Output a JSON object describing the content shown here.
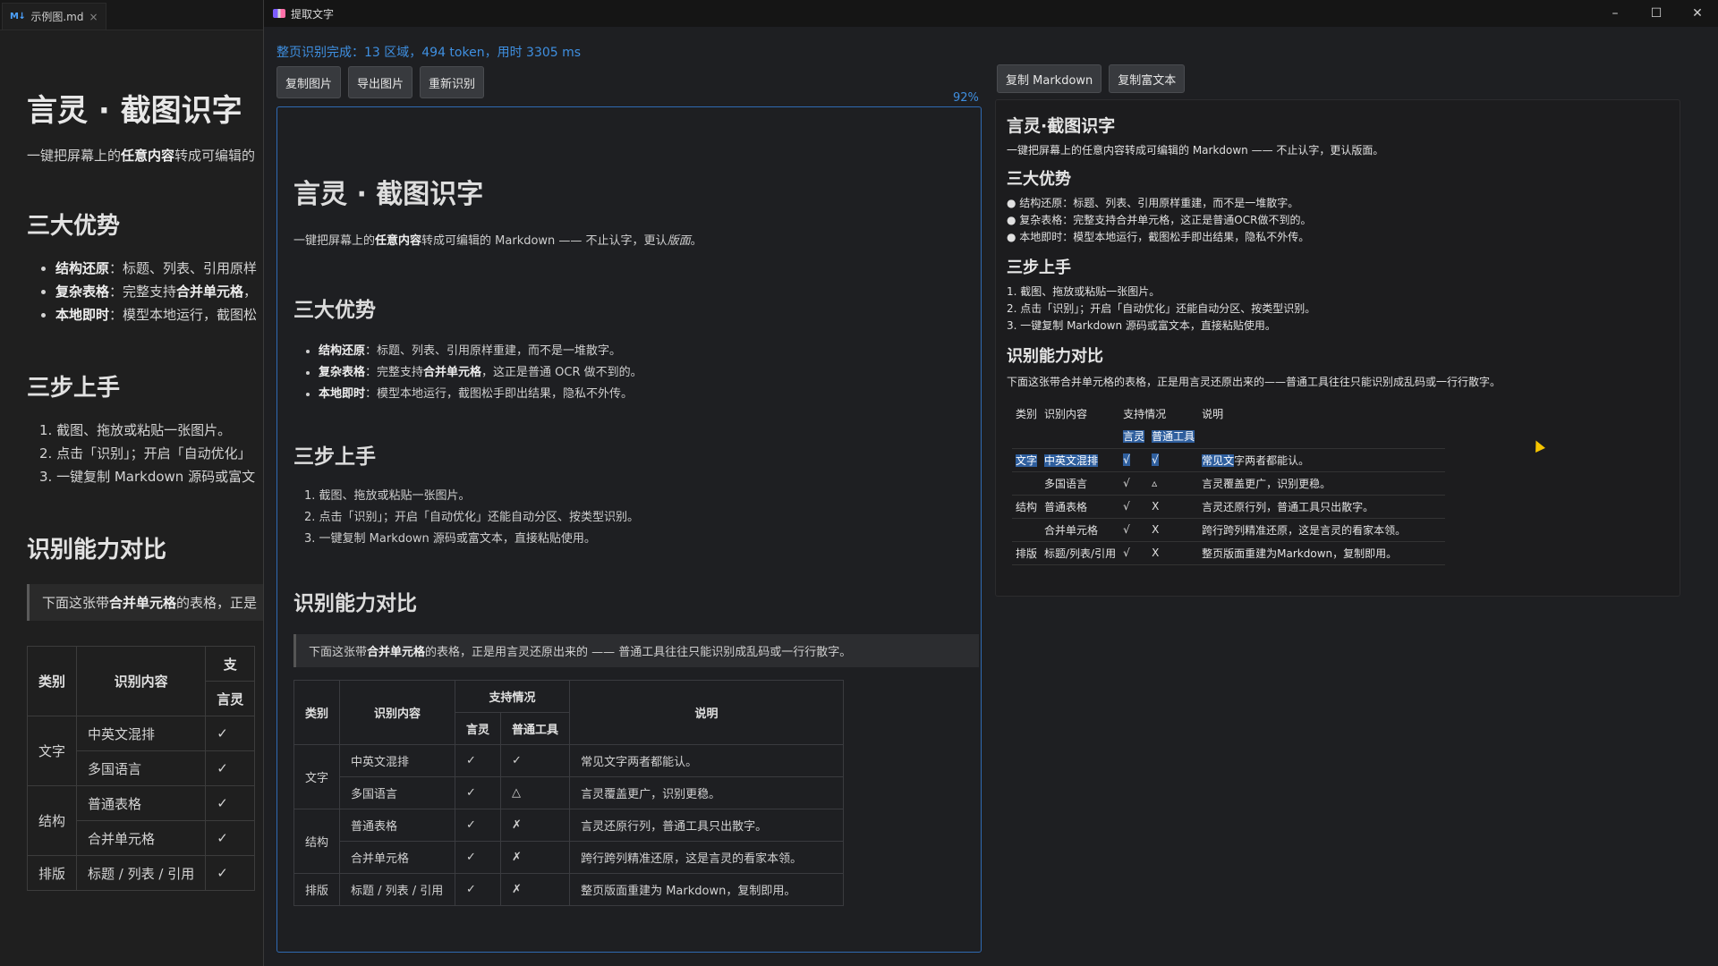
{
  "editor": {
    "tab_icon": "M↓",
    "tab_title": "示例图.md",
    "tab_close": "×",
    "h1": "言灵 · 截图识字",
    "intro_pre": "一键把屏幕上的",
    "intro_bold": "任意内容",
    "intro_post": "转成可编辑的",
    "h2_adv": "三大优势",
    "adv": [
      {
        "bold": "结构还原",
        "text": "：标题、列表、引用原样"
      },
      {
        "bold": "复杂表格",
        "text": "：完整支持",
        "bold2": "合并单元格",
        "tail": "，"
      },
      {
        "bold": "本地即时",
        "text": "：模型本地运行，截图松"
      }
    ],
    "h2_steps": "三步上手",
    "steps": [
      "1. 截图、拖放或粘贴一张图片。",
      "2. 点击「识别」；开启「自动优化」",
      "3. 一键复制 Markdown 源码或富文"
    ],
    "h2_cmp": "识别能力对比",
    "quote_pre": "下面这张带",
    "quote_bold": "合并单元格",
    "quote_post": "的表格，正是",
    "table": {
      "h_cat": "类别",
      "h_content": "识别内容",
      "h_support": "支",
      "h_yl": "言灵",
      "rows": [
        {
          "cat": "文字",
          "item": "中英文混排",
          "yl": "✓"
        },
        {
          "cat": "",
          "item": "多国语言",
          "yl": "✓"
        },
        {
          "cat": "结构",
          "item": "普通表格",
          "yl": "✓"
        },
        {
          "cat": "",
          "item": "合并单元格",
          "yl": "✓"
        },
        {
          "cat": "排版",
          "item": "标题 / 列表 / 引用",
          "yl": "✓"
        }
      ]
    }
  },
  "window": {
    "title": "提取文字",
    "minimize": "–",
    "maximize": "☐",
    "close": "✕"
  },
  "status": "整页识别完成：13 区域，494 token，用时 3305 ms",
  "buttons": {
    "copy_image": "复制图片",
    "export_image": "导出图片",
    "rerecognize": "重新识别",
    "copy_markdown": "复制 Markdown",
    "copy_rich": "复制富文本"
  },
  "zoom": "92%",
  "preview": {
    "h1": "言灵 · 截图识字",
    "intro_pre": "一键把屏幕上的",
    "intro_bold": "任意内容",
    "intro_post": "转成可编辑的 Markdown —— 不止认字，更认",
    "intro_em": "版面",
    "intro_end": "。",
    "h2_adv": "三大优势",
    "adv": [
      {
        "bold": "结构还原",
        "text": "：标题、列表、引用原样重建，而不是一堆散字。"
      },
      {
        "bold": "复杂表格",
        "text": "：完整支持",
        "bold2": "合并单元格",
        "tail": "，这正是普通 OCR 做不到的。"
      },
      {
        "bold": "本地即时",
        "text": "：模型本地运行，截图松手即出结果，隐私不外传。"
      }
    ],
    "h2_steps": "三步上手",
    "steps": [
      "1. 截图、拖放或粘贴一张图片。",
      "2. 点击「识别」；开启「自动优化」还能自动分区、按类型识别。",
      "3. 一键复制 Markdown 源码或富文本，直接粘贴使用。"
    ],
    "h2_cmp": "识别能力对比",
    "quote_pre": "下面这张带",
    "quote_bold": "合并单元格",
    "quote_post": "的表格，正是用言灵还原出来的 —— 普通工具往往只能识别成乱码或一行行散字。",
    "table": {
      "h_cat": "类别",
      "h_content": "识别内容",
      "h_support": "支持情况",
      "h_desc": "说明",
      "h_yl": "言灵",
      "h_tool": "普通工具",
      "rows": [
        {
          "cat": "文字",
          "item": "中英文混排",
          "yl": "✓",
          "tool": "✓",
          "desc": "常见文字两者都能认。"
        },
        {
          "item": "多国语言",
          "yl": "✓",
          "tool": "△",
          "desc": "言灵覆盖更广，识别更稳。"
        },
        {
          "cat": "结构",
          "item": "普通表格",
          "yl": "✓",
          "tool": "✗",
          "desc": "言灵还原行列，普通工具只出散字。"
        },
        {
          "item": "合并单元格",
          "yl": "✓",
          "tool": "✗",
          "desc": "跨行跨列精准还原，这是言灵的看家本领。"
        },
        {
          "cat": "排版",
          "item": "标题 / 列表 / 引用",
          "yl": "✓",
          "tool": "✗",
          "desc": "整页版面重建为 Markdown，复制即用。"
        }
      ]
    }
  },
  "rich": {
    "h1": "言灵·截图识字",
    "intro": "一键把屏幕上的任意内容转成可编辑的 Markdown —— 不止认字，更认版面。",
    "h2_adv": "三大优势",
    "adv": [
      "● 结构还原：标题、列表、引用原样重建，而不是一堆散字。",
      "● 复杂表格：完整支持合并单元格，这正是普通OCR做不到的。",
      "● 本地即时：模型本地运行，截图松手即出结果，隐私不外传。"
    ],
    "h2_steps": "三步上手",
    "steps": [
      "1. 截图、拖放或粘贴一张图片。",
      "2. 点击「识别」；开启「自动优化」还能自动分区、按类型识别。",
      "3. 一键复制 Markdown 源码或富文本，直接粘贴使用。"
    ],
    "h2_cmp": "识别能力对比",
    "cmp_intro": "下面这张带合并单元格的表格，正是用言灵还原出来的——普通工具往往只能识别成乱码或一行行散字。",
    "table": {
      "h_cat": "类别",
      "h_content": "识别内容",
      "h_support": "支持情况",
      "h_desc": "说明",
      "h_yl": "言灵",
      "h_tool": "普通工具",
      "rows": [
        {
          "cat": "文字",
          "item": "中英文混排",
          "yl": "√",
          "tool": "√",
          "desc_sel": "常见文",
          "desc": "字两者都能认。"
        },
        {
          "cat": "",
          "item": "多国语言",
          "yl": "√",
          "tool": "▵",
          "desc": "言灵覆盖更广，识别更稳。"
        },
        {
          "cat": "结构",
          "item": "普通表格",
          "yl": "√",
          "tool": "X",
          "desc": "言灵还原行列，普通工具只出散字。"
        },
        {
          "cat": "",
          "item": "合并单元格",
          "yl": "√",
          "tool": "X",
          "desc": "跨行跨列精准还原，这是言灵的看家本领。"
        },
        {
          "cat": "排版",
          "item": "标题/列表/引用",
          "yl": "√",
          "tool": "X",
          "desc": "整页版面重建为Markdown，复制即用。"
        }
      ]
    }
  }
}
